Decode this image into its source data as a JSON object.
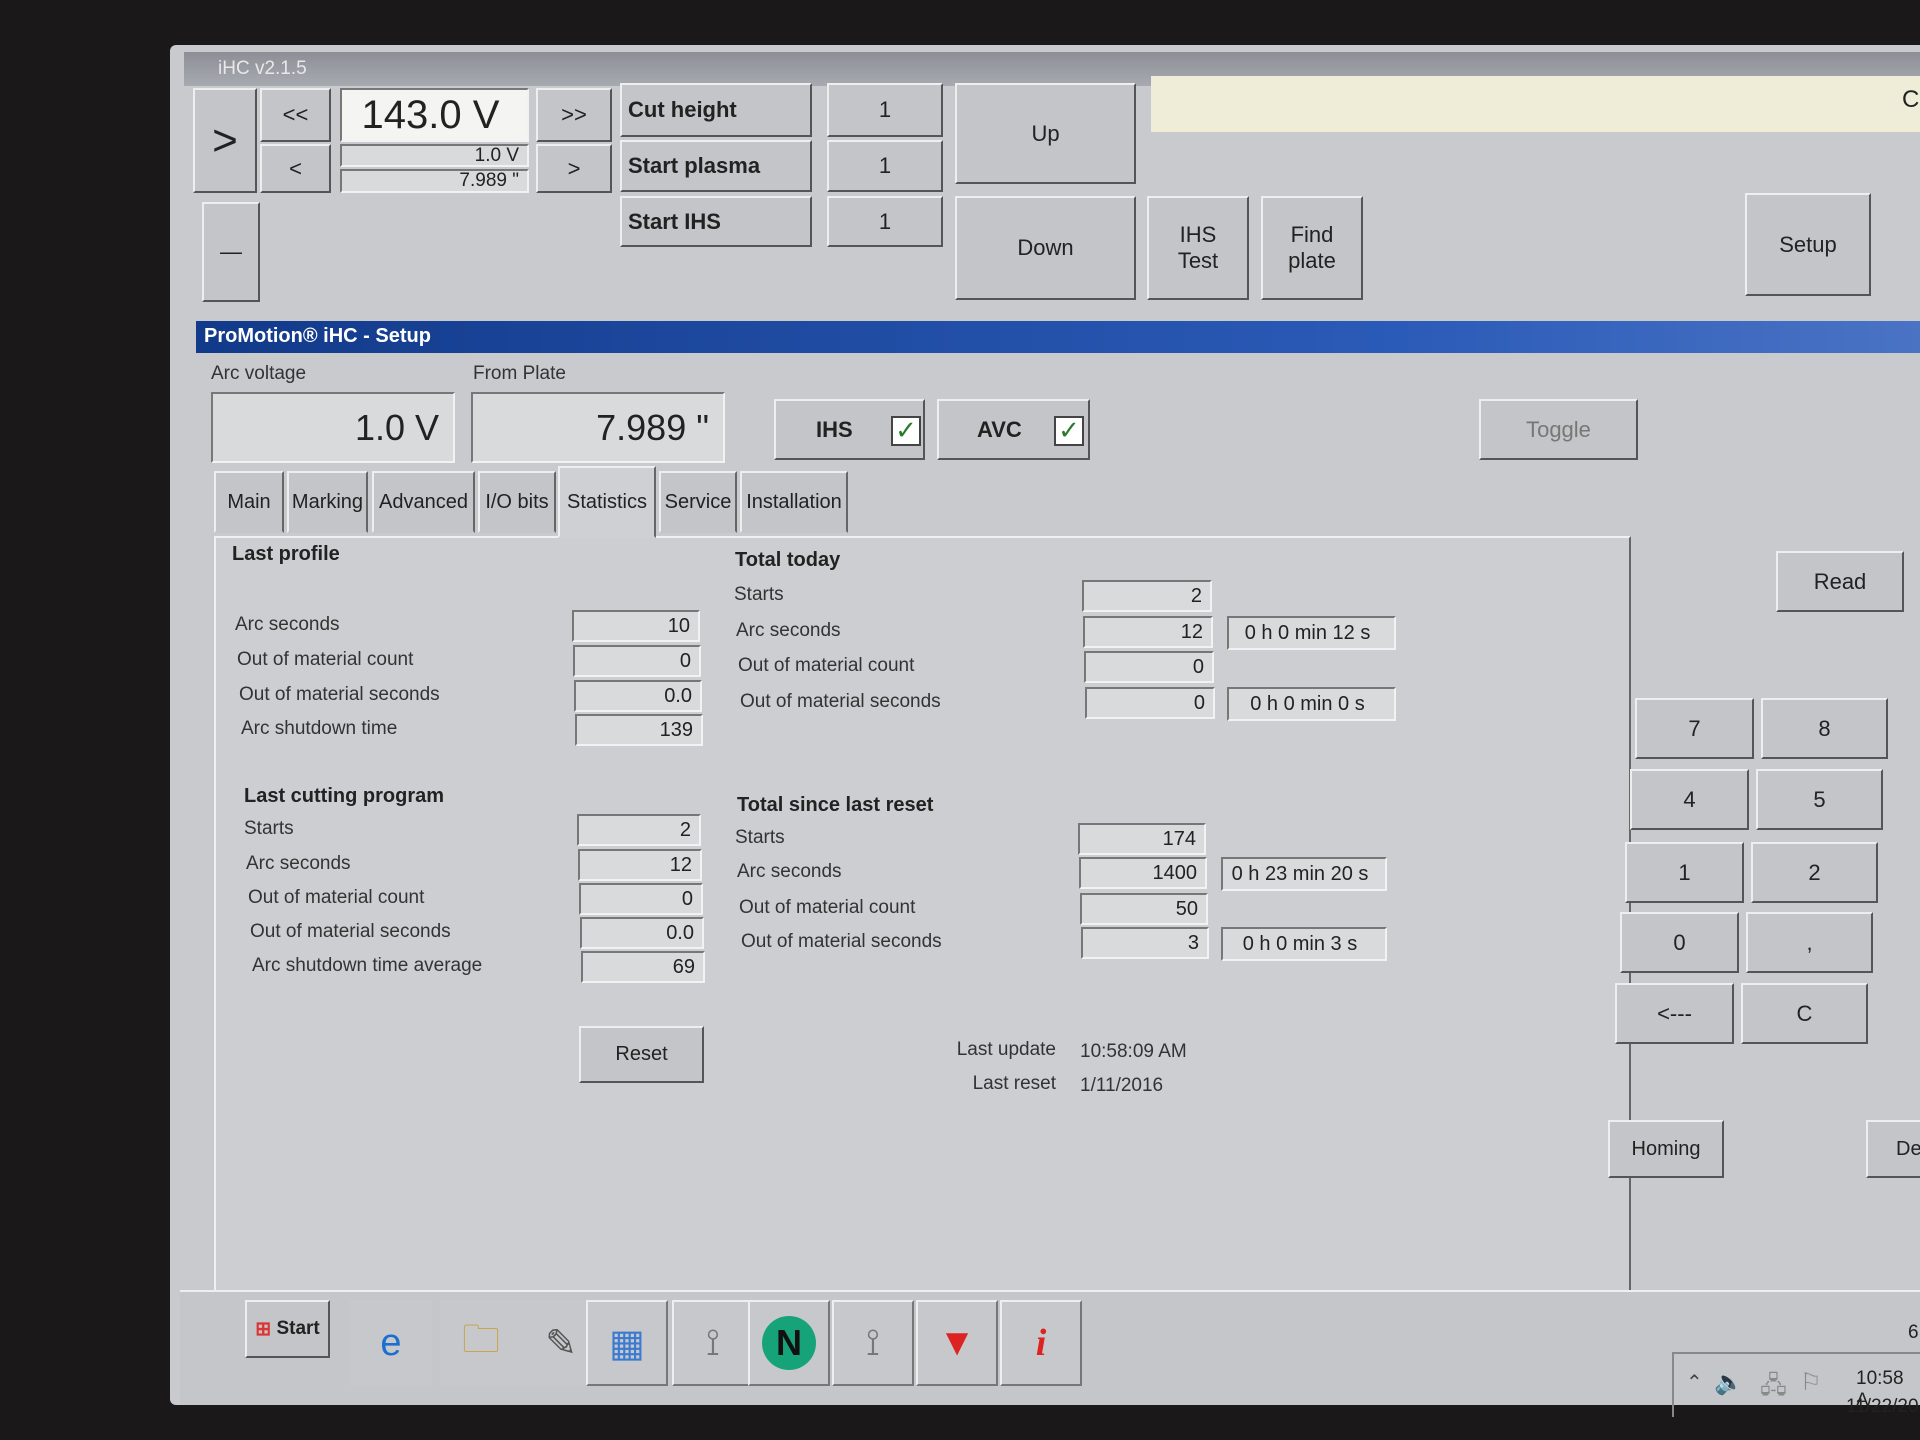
{
  "window": {
    "title": "iHC v2.1.5"
  },
  "toolbar": {
    "arrow_right": ">",
    "fast_left": "<<",
    "left": "<",
    "fast_right": ">>",
    "right": ">",
    "minus": "—",
    "arc_voltage_main": "143.0 V",
    "arc_voltage_small": "1.0 V",
    "height_small": "7.989 \"",
    "params": [
      {
        "label": "Cut height",
        "value": "1"
      },
      {
        "label": "Start plasma",
        "value": "1"
      },
      {
        "label": "Start IHS",
        "value": "1"
      }
    ],
    "up": "Up",
    "down": "Down",
    "ihs_test": "IHS Test",
    "find_plate": "Find plate",
    "setup": "Setup",
    "status_text": "",
    "right_edge_char": "C"
  },
  "setup": {
    "title": "ProMotion® iHC - Setup",
    "arc_voltage_label": "Arc voltage",
    "arc_voltage_value": "1.0 V",
    "from_plate_label": "From Plate",
    "from_plate_value": "7.989 \"",
    "ihs_label": "IHS",
    "ihs_checked": true,
    "avc_label": "AVC",
    "avc_checked": true,
    "toggle": "Toggle"
  },
  "tabs": [
    {
      "label": "Main"
    },
    {
      "label": "Marking"
    },
    {
      "label": "Advanced"
    },
    {
      "label": "I/O bits"
    },
    {
      "label": "Statistics",
      "active": true
    },
    {
      "label": "Service"
    },
    {
      "label": "Installation"
    }
  ],
  "stats": {
    "last_profile": {
      "title": "Last profile",
      "rows": [
        {
          "label": "Arc seconds",
          "value": "10"
        },
        {
          "label": "Out of material count",
          "value": "0"
        },
        {
          "label": "Out of material seconds",
          "value": "0.0"
        },
        {
          "label": "Arc shutdown time",
          "value": "139"
        }
      ]
    },
    "last_program": {
      "title": "Last cutting program",
      "rows": [
        {
          "label": "Starts",
          "value": "2"
        },
        {
          "label": "Arc seconds",
          "value": "12"
        },
        {
          "label": "Out of material count",
          "value": "0"
        },
        {
          "label": "Out of material seconds",
          "value": "0.0"
        },
        {
          "label": "Arc shutdown time average",
          "value": "69"
        }
      ]
    },
    "total_today": {
      "title": "Total today",
      "rows": [
        {
          "label": "Starts",
          "value": "2"
        },
        {
          "label": "Arc seconds",
          "value": "12",
          "time": "0 h 0 min 12 s"
        },
        {
          "label": "Out of material count",
          "value": "0"
        },
        {
          "label": "Out of material seconds",
          "value": "0",
          "time": "0 h 0 min 0 s"
        }
      ]
    },
    "total_reset": {
      "title": "Total since last reset",
      "rows": [
        {
          "label": "Starts",
          "value": "174"
        },
        {
          "label": "Arc seconds",
          "value": "1400",
          "time": "0 h 23 min 20 s"
        },
        {
          "label": "Out of material count",
          "value": "50"
        },
        {
          "label": "Out of material seconds",
          "value": "3",
          "time": "0 h 0 min 3 s"
        }
      ]
    },
    "reset": "Reset",
    "last_update_label": "Last update",
    "last_update": "10:58:09 AM",
    "last_reset_label": "Last reset",
    "last_reset": "1/11/2016"
  },
  "keypad": {
    "read": "Read",
    "keys": [
      "7",
      "8",
      "4",
      "5",
      "1",
      "2",
      "0",
      ",",
      "<---",
      "C"
    ],
    "homing": "Homing",
    "de": "De"
  },
  "taskbar": {
    "start": "Start",
    "time": "10:58 A",
    "date": "11/22/20",
    "edge_char": "6"
  }
}
